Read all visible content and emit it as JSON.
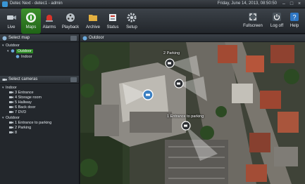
{
  "window": {
    "title": "Detec Next - detec1 - admin",
    "datetime": "Friday, June 14, 2013, 08:50:50"
  },
  "toolbar": {
    "items": [
      {
        "label": "Live",
        "icon": "camera-icon"
      },
      {
        "label": "Maps",
        "icon": "map-pin-icon"
      },
      {
        "label": "Alarms",
        "icon": "alarm-light-icon"
      },
      {
        "label": "Playback",
        "icon": "film-reel-icon"
      },
      {
        "label": "Archive",
        "icon": "folder-icon"
      },
      {
        "label": "Status",
        "icon": "status-icon"
      },
      {
        "label": "Setup",
        "icon": "gear-icon"
      }
    ],
    "right_items": [
      {
        "label": "Fullscreen",
        "icon": "fullscreen-icon"
      },
      {
        "label": "Log off",
        "icon": "log-off-icon"
      },
      {
        "label": "Help",
        "icon": "help-icon"
      }
    ],
    "active": "Maps",
    "accent": "#2e8b26"
  },
  "select_map": {
    "title": "Select map",
    "tree": [
      {
        "label": "Outdoor"
      },
      {
        "label": "Outdoor",
        "selected": true
      },
      {
        "label": "Indoor"
      }
    ]
  },
  "select_cameras": {
    "title": "Select cameras",
    "groups": [
      {
        "label": "Indoor",
        "cameras": [
          "3 Entrance",
          "4 Storage room",
          "5 Hallway",
          "6 Back door",
          "7 DVD"
        ]
      },
      {
        "label": "Outdoor",
        "cameras": [
          "1 Entrance to parking",
          "2 Parking",
          "8"
        ]
      }
    ]
  },
  "map": {
    "title": "Outdoor",
    "camera_markers": [
      {
        "label": "2 Parking"
      },
      {
        "label": "1 Entrance to parking"
      }
    ]
  }
}
